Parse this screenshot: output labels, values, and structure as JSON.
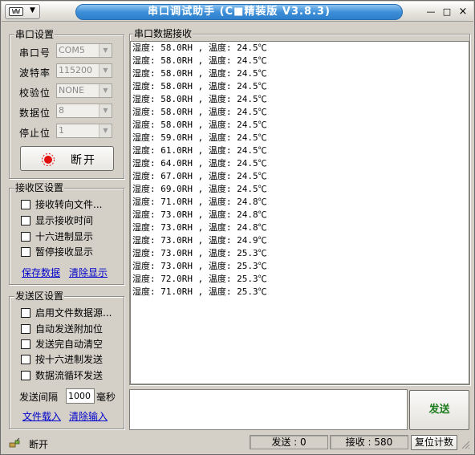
{
  "window": {
    "title": "串口调试助手 (C■精装版 V3.8.3)",
    "sysmenu_logo": "WW",
    "sysmenu_arrow": "▼",
    "min_label": "—",
    "restore_label": "□",
    "close_label": "×"
  },
  "serial_settings": {
    "title": "串口设置",
    "port_label": "串口号",
    "port_value": "COM5",
    "baud_label": "波特率",
    "baud_value": "115200",
    "parity_label": "校验位",
    "parity_value": "NONE",
    "databits_label": "数据位",
    "databits_value": "8",
    "stopbits_label": "停止位",
    "stopbits_value": "1",
    "toggle_label": "断开",
    "drop_arrow": "▼"
  },
  "receive_settings": {
    "title": "接收区设置",
    "options": [
      "接收转向文件...",
      "显示接收时间",
      "十六进制显示",
      "暂停接收显示"
    ],
    "save_link": "保存数据",
    "clear_link": "清除显示"
  },
  "send_settings": {
    "title": "发送区设置",
    "options": [
      "启用文件数据源...",
      "自动发送附加位",
      "发送完自动清空",
      "按十六进制发送",
      "数据流循环发送"
    ],
    "interval_label": "发送间隔",
    "interval_value": "1000",
    "interval_unit": "毫秒",
    "load_link": "文件载入",
    "clear_link": "清除输入"
  },
  "receive_area": {
    "title": "串口数据接收",
    "lines": [
      "湿度: 58.0RH , 温度: 24.5℃",
      "湿度: 58.0RH , 温度: 24.5℃",
      "湿度: 58.0RH , 温度: 24.5℃",
      "湿度: 58.0RH , 温度: 24.5℃",
      "湿度: 58.0RH , 温度: 24.5℃",
      "湿度: 58.0RH , 温度: 24.5℃",
      "湿度: 58.0RH , 温度: 24.5℃",
      "湿度: 59.0RH , 温度: 24.5℃",
      "湿度: 61.0RH , 温度: 24.5℃",
      "湿度: 64.0RH , 温度: 24.5℃",
      "湿度: 67.0RH , 温度: 24.5℃",
      "湿度: 69.0RH , 温度: 24.5℃",
      "湿度: 71.0RH , 温度: 24.8℃",
      "湿度: 73.0RH , 温度: 24.8℃",
      "湿度: 73.0RH , 温度: 24.8℃",
      "湿度: 73.0RH , 温度: 24.9℃",
      "湿度: 73.0RH , 温度: 25.3℃",
      "湿度: 73.0RH , 温度: 25.3℃",
      "湿度: 72.0RH , 温度: 25.3℃",
      "湿度: 71.0RH , 温度: 25.3℃"
    ]
  },
  "send_area": {
    "input_value": "",
    "send_button": "发送"
  },
  "status_bar": {
    "connection": "断开",
    "sent": "发送 : 0",
    "received": "接收 : 580",
    "reset_button": "复位计数"
  },
  "colors": {
    "title_bar": "#3d8fd8",
    "send_button_text": "#1e7d1e",
    "link": "#0000cc",
    "indicator": "#e01010"
  }
}
